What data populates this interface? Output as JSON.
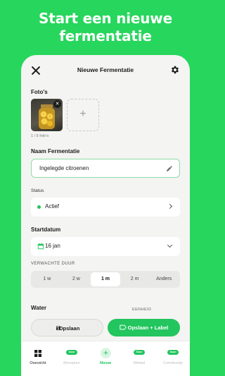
{
  "promo": {
    "line1": "Start een nieuwe",
    "line2": "fermentatie"
  },
  "header": {
    "title": "Nieuwe Fermentatie"
  },
  "photos": {
    "label": "Foto's",
    "count": "1 / 5 foto's",
    "remove": "✕",
    "add": "+"
  },
  "name_field": {
    "label": "Naam Fermentatie",
    "value": "Ingelegde citroenen"
  },
  "status": {
    "label": "Status",
    "value": "Actief",
    "dot_color": "#27c35a"
  },
  "start_date": {
    "label": "Startdatum",
    "value": "16 jan"
  },
  "duration": {
    "label": "VERWACHTE DUUR",
    "options": [
      "1 w",
      "2 w",
      "1 m",
      "2 m",
      "Anders"
    ],
    "selected": "1 m"
  },
  "water": {
    "label": "Water",
    "unit_label": "EENHEID"
  },
  "actions": {
    "save": "Opslaan",
    "save_label": "Opslaan + Label"
  },
  "tabbar": {
    "items": [
      {
        "label": "Overzicht",
        "icon": "grid-icon"
      },
      {
        "label": "Recepten",
        "badge": "Soon"
      },
      {
        "label": "Nieuw",
        "icon": "plus-icon"
      },
      {
        "label": "Winkel",
        "badge": "Soon"
      },
      {
        "label": "Community",
        "badge": "Soon"
      }
    ]
  },
  "colors": {
    "background": "#27d65c",
    "accent": "#22c55e"
  }
}
